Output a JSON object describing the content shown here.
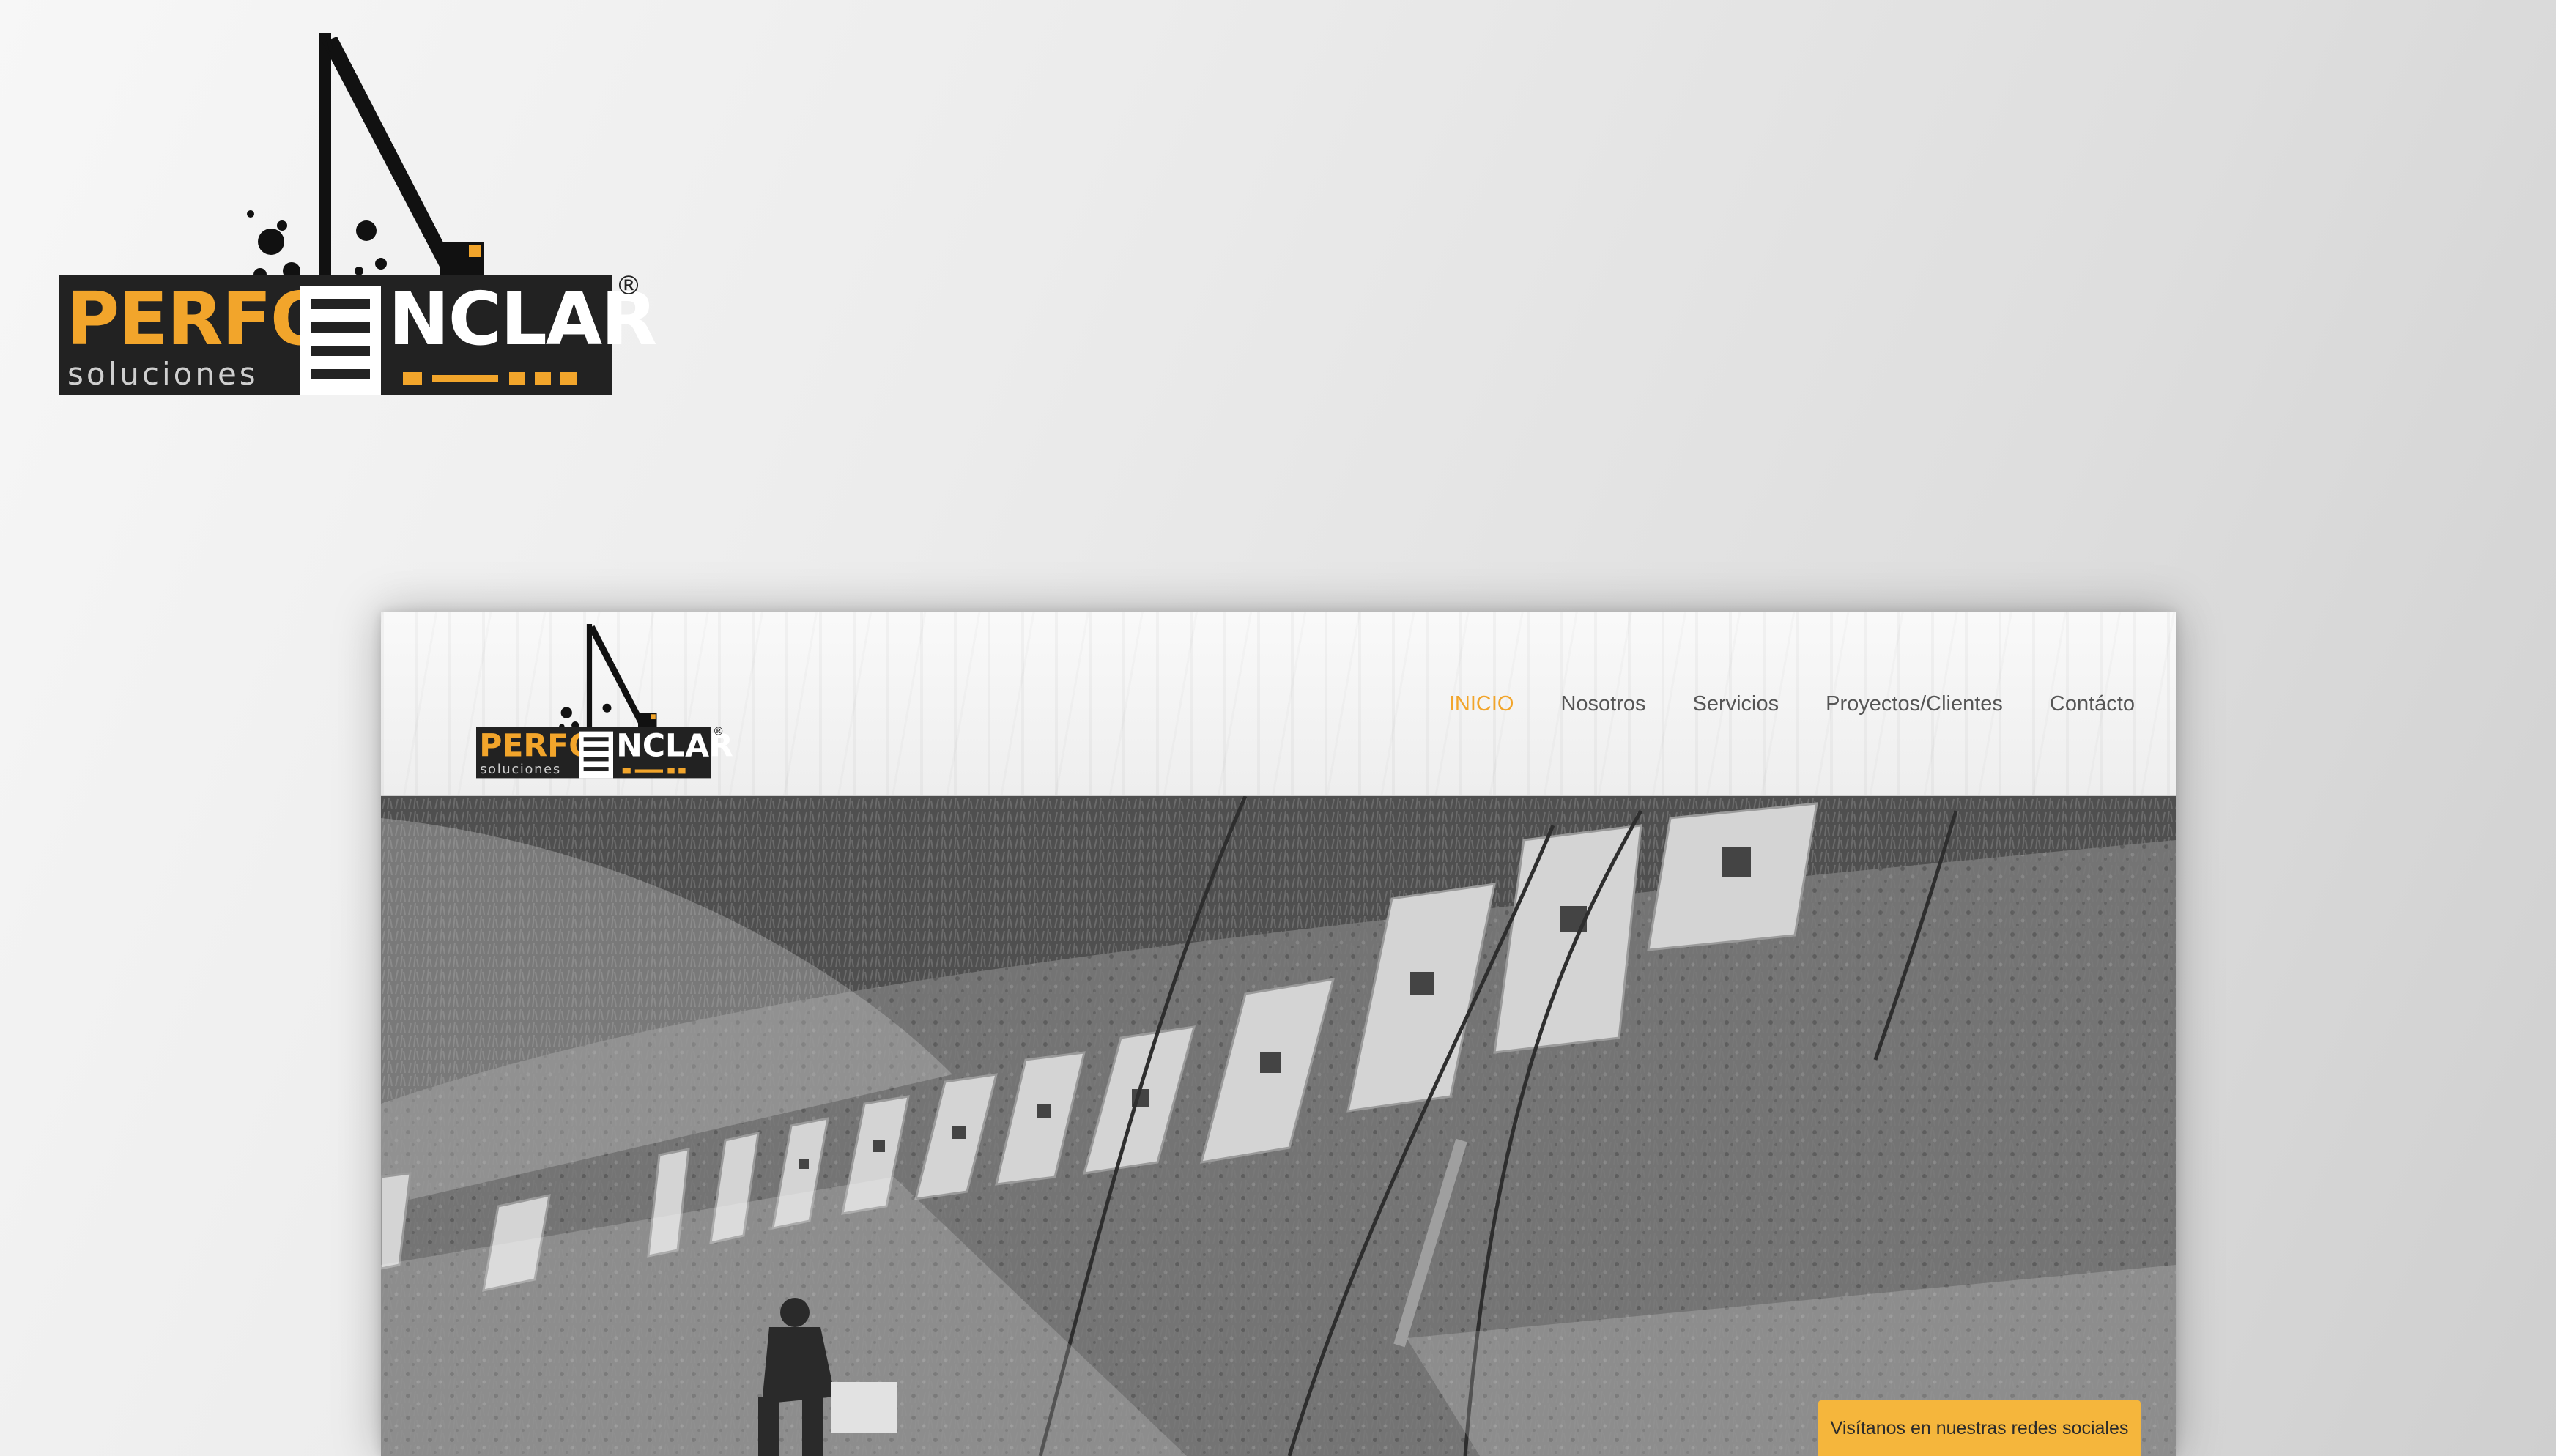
{
  "brand": {
    "name_left": "PERFO",
    "name_right": "NCLAR",
    "tagline": "soluciones",
    "registered_mark": "®",
    "accent_color": "#f2a52b",
    "dark_color": "#222222"
  },
  "site": {
    "nav": {
      "items": [
        {
          "label": "INICIO",
          "active": true
        },
        {
          "label": "Nosotros",
          "active": false
        },
        {
          "label": "Servicios",
          "active": false
        },
        {
          "label": "Proyectos/Clientes",
          "active": false
        },
        {
          "label": "Contácto",
          "active": false
        }
      ]
    },
    "social_badge": "Visítanos en nuestras redes sociales"
  }
}
